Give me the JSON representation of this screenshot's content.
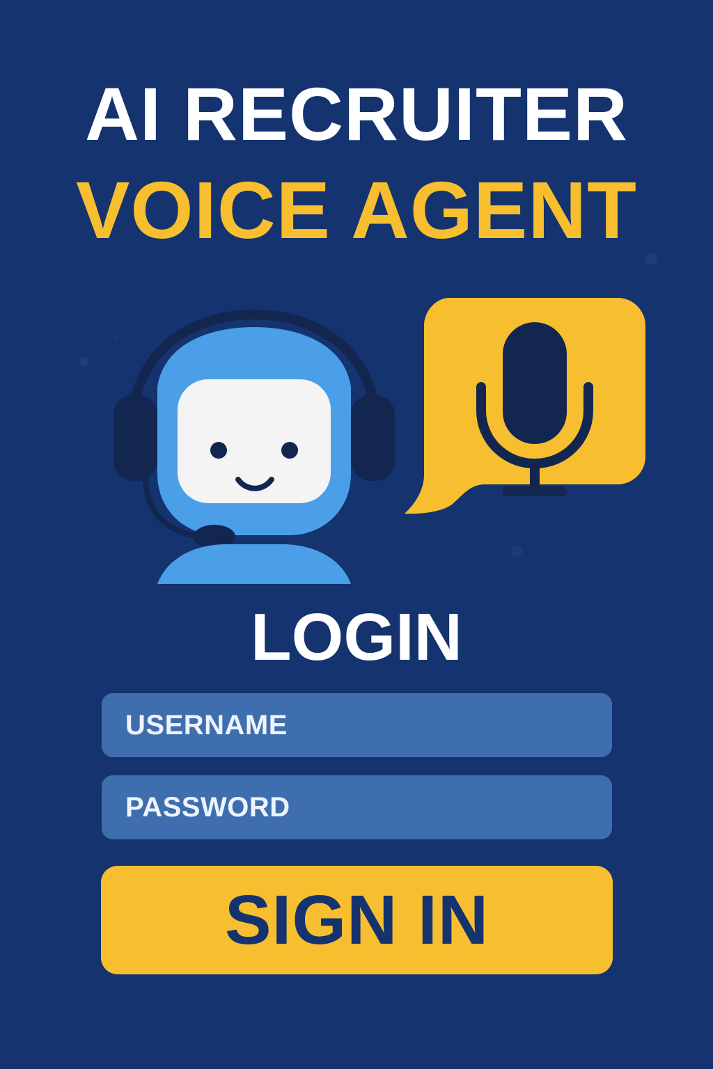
{
  "app": {
    "title_line_1": "AI RECRUITER",
    "title_line_2": "VOICE AGENT"
  },
  "hero": {
    "robot_icon": "robot-headset-icon",
    "mic_icon": "microphone-icon"
  },
  "login": {
    "heading": "LOGIN",
    "username": {
      "placeholder": "USERNAME",
      "value": ""
    },
    "password": {
      "placeholder": "PASSWORD",
      "value": ""
    },
    "sign_in_label": "SIGN IN"
  },
  "colors": {
    "background": "#14336f",
    "accent_yellow": "#f7be2f",
    "field_blue": "#3f6eae",
    "robot_blue": "#4a9fe8",
    "dark_navy": "#12264f",
    "white": "#ffffff"
  }
}
